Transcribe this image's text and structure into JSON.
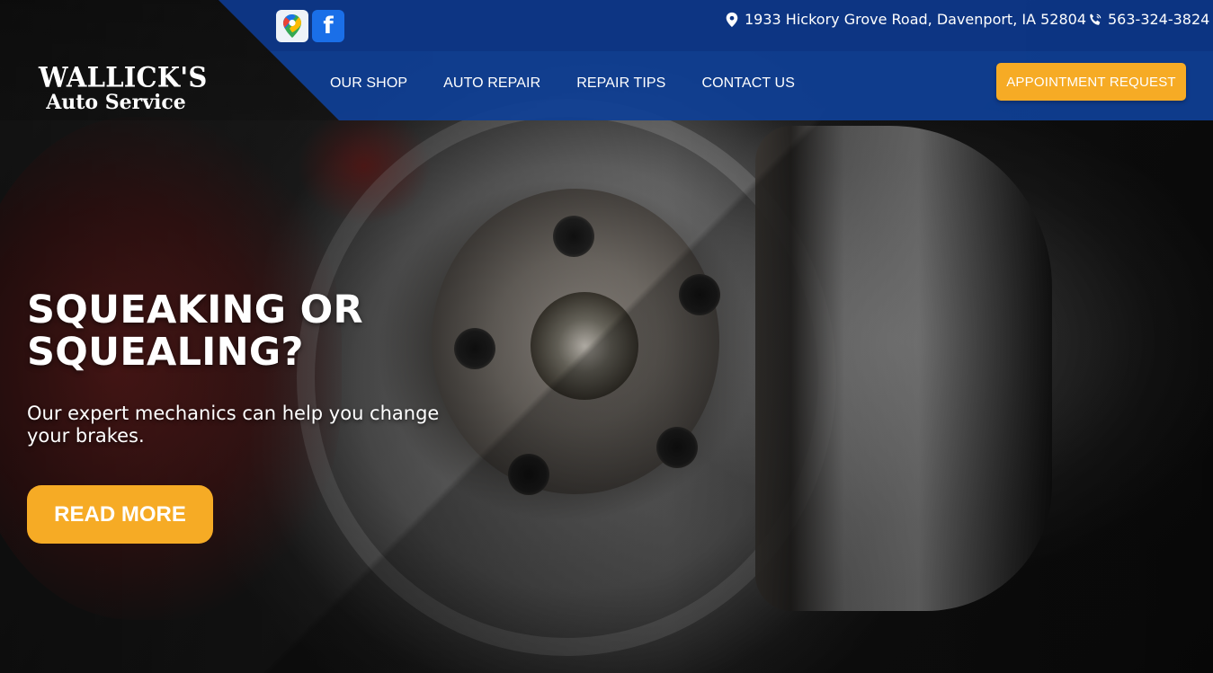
{
  "brand": {
    "logo_line1": "WALLICK'S",
    "logo_line2": "Auto Service"
  },
  "social": {
    "maps_icon": "google-maps-icon",
    "facebook_icon": "facebook-icon",
    "facebook_glyph": "f"
  },
  "contact": {
    "address": "1933 Hickory Grove Road, Davenport, IA 52804",
    "phone": "563-324-3824"
  },
  "nav": {
    "items": [
      {
        "label": "OUR SHOP"
      },
      {
        "label": "AUTO REPAIR"
      },
      {
        "label": "REPAIR TIPS"
      },
      {
        "label": "CONTACT US"
      }
    ],
    "cta": "APPOINTMENT REQUEST"
  },
  "hero": {
    "headline_line1": "SQUEAKING OR",
    "headline_line2": "SQUEALING?",
    "subline_line1": "Our expert mechanics can help you change",
    "subline_line2": "your brakes.",
    "button": "READ MORE"
  },
  "colors": {
    "primary_blue": "#0f3f96",
    "accent_orange": "#f6ab25",
    "facebook_blue": "#1a6fe8"
  }
}
